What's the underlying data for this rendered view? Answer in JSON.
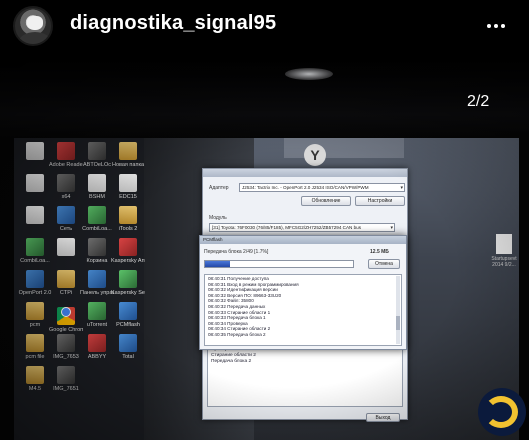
{
  "header": {
    "username": "diagnostika_signal95"
  },
  "carousel": {
    "counter": "2/2"
  },
  "desktop": {
    "icons": [
      {
        "label": "",
        "kind": "doc"
      },
      {
        "label": "Adobe Reader",
        "kind": "red"
      },
      {
        "label": "ABTOeLOc",
        "kind": "dark"
      },
      {
        "label": "Новая папка",
        "kind": "folder"
      },
      {
        "label": "",
        "kind": "doc"
      },
      {
        "label": "x64",
        "kind": "dark"
      },
      {
        "label": "BSHM",
        "kind": "doc"
      },
      {
        "label": "EDC15",
        "kind": "doc"
      },
      {
        "label": "",
        "kind": "doc"
      },
      {
        "label": "Сеть",
        "kind": "app"
      },
      {
        "label": "CombiLoa...",
        "kind": "green"
      },
      {
        "label": "iTools 2",
        "kind": "folder"
      },
      {
        "label": "CombiLoa...",
        "kind": "green"
      },
      {
        "label": "",
        "kind": "doc"
      },
      {
        "label": "Корзина",
        "kind": "dark"
      },
      {
        "label": "Kaspersky Anti-Virus",
        "kind": "red"
      },
      {
        "label": "OpenPort 2.0",
        "kind": "app"
      },
      {
        "label": "CTPi",
        "kind": "folder"
      },
      {
        "label": "Панель управления",
        "kind": "app"
      },
      {
        "label": "Kaspersky Secure Co...",
        "kind": "green"
      },
      {
        "label": "pcm",
        "kind": "folder"
      },
      {
        "label": "Google Chrome",
        "kind": "chrome"
      },
      {
        "label": "uTorrent",
        "kind": "green"
      },
      {
        "label": "PCMflash",
        "kind": "app"
      },
      {
        "label": "pcm file",
        "kind": "folder"
      },
      {
        "label": "IMG_7653",
        "kind": "dark"
      },
      {
        "label": "ABBYY",
        "kind": "red"
      },
      {
        "label": "Total",
        "kind": "app"
      },
      {
        "label": "M4.5",
        "kind": "folder"
      },
      {
        "label": "IMG_7651",
        "kind": "dark"
      }
    ],
    "right_file": "Startupsevt 2014 9/2..."
  },
  "app_window": {
    "adapter_label": "Адаптер",
    "adapter_value": "J2534: Tactrix Inc. - OpenPort 2.0 J2534 ISO/CAN/VPW/PWM",
    "refresh_label": "Обновление",
    "settings_label": "Настройки",
    "module_label": "Модуль",
    "module_value": "[31] Toyota: 76F0030 (76/85/F185), MFC5G2/ZH7252/ZB57294 CAN bus",
    "log_lines": [
      "Передача данных",
      "Стирание области 1",
      "Передача блока 1",
      "Проверка",
      "Стирание области 2",
      "Передача блока 2"
    ],
    "exit_label": "Выход"
  },
  "dialog": {
    "title": "PCMflash",
    "status": "Передача блока 2/49 [1.7%]",
    "size": "12.5 МБ",
    "cancel_label": "Отмена",
    "progress_percent": 17,
    "lines": [
      "08:40:31 Получение доступа",
      "08:40:31 Вход в режим программирования",
      "08:40:32 Идентификация версии",
      "08:40:32 Версия ПО: 89663-33U20",
      "08:40:32 Файл: 35800",
      "08:40:32 Передача данных",
      "08:40:33 Стирание области 1",
      "08:40:33 Передача блока 1",
      "08:40:34 Проверка",
      "08:40:34 Стирание области 2",
      "08:40:35 Передача блока 2"
    ]
  },
  "colors": {
    "background": "#000000",
    "progress": "#2f5bc0",
    "watermark_ring": "#f2c230",
    "watermark_bg": "#0b1a3c"
  }
}
